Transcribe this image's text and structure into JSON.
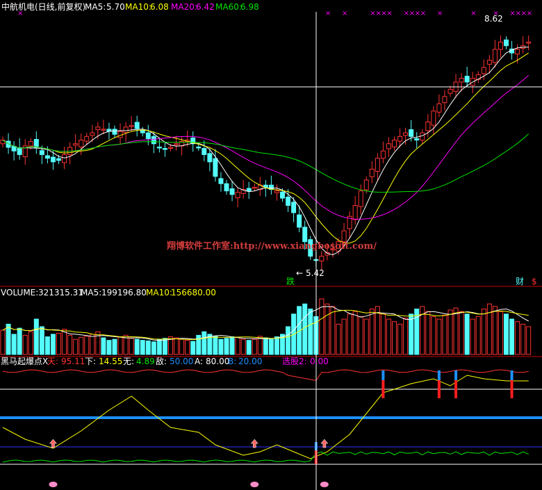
{
  "header": {
    "stock_name": "中航机电(日线,前复权)",
    "ma5_label": "MA5:",
    "ma5_value": "5.70",
    "ma10_label": "MA10:",
    "ma10_value": "6.08",
    "ma20_label": "MA20:",
    "ma20_value": "6.42",
    "ma60_label": "MA60:",
    "ma60_value": "6.98"
  },
  "colors": {
    "background": "#000000",
    "up": "#ff3232",
    "down": "#54fcfc",
    "ma5": "#ffffff",
    "ma10": "#ffff00",
    "ma20": "#ff00ff",
    "ma60": "#00e600",
    "divider": "#c80000",
    "signal_blue": "#1e90ff",
    "signal_red": "#ff1e1e"
  },
  "annotations": {
    "high_price": "8.62",
    "low_price": "5.42",
    "low_arrow": "←",
    "watermark": "翔博软件工作室:http://www.xiangbosoft.com/",
    "tag_fall": "跌",
    "tag_finance": "财",
    "tag_dollar": "$",
    "x_marker": "×"
  },
  "volume_header": {
    "label": "VOLUME:",
    "value": "321315.31",
    "ma5_label": "MA5:",
    "ma5_value": "199196.80",
    "ma10_label": "MA10:",
    "ma10_value": "156680.00"
  },
  "indicator_header": {
    "name": "黑马起爆点X",
    "tian_label": "天:",
    "tian_value": "95.11",
    "xia_label": "下:",
    "xia_value": "14.55",
    "wu_label": "无:",
    "wu_value": "4.89",
    "di_label": "敌:",
    "di_value": "50.00",
    "a_label": "A:",
    "a_value": "80.00",
    "b_label": "B:",
    "b_value": "20.00",
    "pick_label": "选股2:",
    "pick_value": "0.00"
  },
  "chart_data": [
    {
      "type": "candlestick",
      "title": "中航机电(日线,前复权)",
      "series": [
        {
          "name": "MA5",
          "last_value": 5.7
        },
        {
          "name": "MA10",
          "last_value": 6.08
        },
        {
          "name": "MA20",
          "last_value": 6.42
        },
        {
          "name": "MA60",
          "last_value": 6.98
        }
      ],
      "ylim": [
        5.2,
        8.8
      ],
      "annotations": {
        "high": 8.62,
        "low": 5.42
      },
      "closes_estimated": [
        7.1,
        7.0,
        6.95,
        6.9,
        7.02,
        7.08,
        7.0,
        6.9,
        6.85,
        6.8,
        6.82,
        6.9,
        7.0,
        7.05,
        7.1,
        7.15,
        7.2,
        7.28,
        7.25,
        7.22,
        7.18,
        7.22,
        7.28,
        7.3,
        7.26,
        7.2,
        7.12,
        7.05,
        7.0,
        6.98,
        7.0,
        7.05,
        7.08,
        7.1,
        7.05,
        7.0,
        6.9,
        6.8,
        6.6,
        6.5,
        6.4,
        6.35,
        6.38,
        6.42,
        6.4,
        6.45,
        6.48,
        6.45,
        6.42,
        6.4,
        6.3,
        6.2,
        6.1,
        5.9,
        5.7,
        5.5,
        5.45,
        5.5,
        5.55,
        5.6,
        5.7,
        5.85,
        6.05,
        6.2,
        6.4,
        6.55,
        6.7,
        6.85,
        6.95,
        7.05,
        7.1,
        7.15,
        7.2,
        7.15,
        7.1,
        7.2,
        7.35,
        7.5,
        7.6,
        7.7,
        7.8,
        7.9,
        7.95,
        7.9,
        7.95,
        8.0,
        8.1,
        8.2,
        8.35,
        8.45,
        8.4,
        8.3,
        8.35,
        8.4,
        8.45
      ]
    },
    {
      "type": "bar",
      "title": "VOLUME",
      "series": [
        {
          "name": "VOLUME",
          "last_value": 321315.31
        },
        {
          "name": "MA5",
          "last_value": 199196.8
        },
        {
          "name": "MA10",
          "last_value": 156680.0
        }
      ],
      "values_estimated": [
        48,
        60,
        40,
        52,
        38,
        45,
        70,
        55,
        35,
        40,
        42,
        50,
        38,
        30,
        34,
        36,
        40,
        45,
        33,
        28,
        30,
        35,
        38,
        32,
        30,
        28,
        27,
        25,
        30,
        32,
        35,
        33,
        30,
        28,
        26,
        38,
        45,
        40,
        36,
        30,
        32,
        35,
        34,
        30,
        28,
        30,
        36,
        33,
        30,
        35,
        40,
        55,
        80,
        95,
        100,
        90,
        75,
        110,
        100,
        95,
        60,
        70,
        80,
        85,
        75,
        70,
        90,
        95,
        80,
        70,
        65,
        60,
        72,
        80,
        90,
        95,
        85,
        75,
        70,
        78,
        88,
        92,
        85,
        80,
        70,
        75,
        90,
        100,
        95,
        85,
        80,
        70,
        65,
        60,
        55
      ]
    },
    {
      "type": "line",
      "title": "黑马起爆点X",
      "series": [
        {
          "name": "天",
          "last_value": 95.11
        },
        {
          "name": "下",
          "last_value": 14.55
        },
        {
          "name": "无",
          "last_value": 4.89
        },
        {
          "name": "敌",
          "last_value": 50.0
        },
        {
          "name": "A",
          "last_value": 80.0
        },
        {
          "name": "B",
          "last_value": 20.0
        },
        {
          "name": "选股2",
          "last_value": 0.0
        }
      ]
    }
  ]
}
